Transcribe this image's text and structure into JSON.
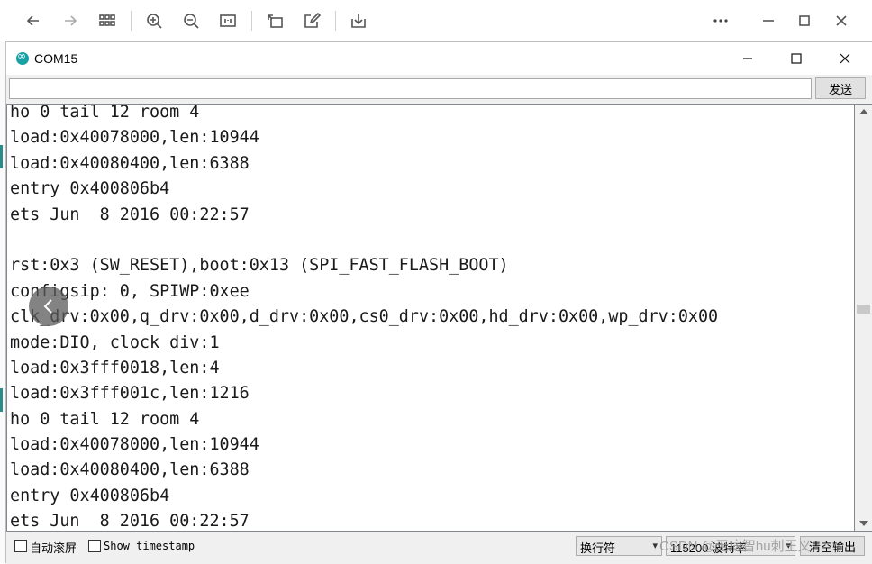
{
  "viewer_toolbar": {
    "icons": [
      "back-arrow-icon",
      "forward-arrow-icon",
      "grid-icon",
      "zoom-in-icon",
      "zoom-out-icon",
      "actual-size-icon",
      "rotate-icon",
      "edit-icon",
      "download-icon",
      "more-icon",
      "minimize-icon",
      "maximize-icon",
      "close-icon"
    ]
  },
  "window": {
    "title": "COM15",
    "controls": [
      "minimize-icon",
      "maximize-icon",
      "close-icon"
    ]
  },
  "send": {
    "input_value": "",
    "button_label": "发送"
  },
  "output": {
    "lines": [
      "ho 0 tail 12 room 4",
      "load:0x40078000,len:10944",
      "load:0x40080400,len:6388",
      "entry 0x400806b4",
      "ets Jun  8 2016 00:22:57",
      "",
      "rst:0x3 (SW_RESET),boot:0x13 (SPI_FAST_FLASH_BOOT)",
      "configsip: 0, SPIWP:0xee",
      "clk_drv:0x00,q_drv:0x00,d_drv:0x00,cs0_drv:0x00,hd_drv:0x00,wp_drv:0x00",
      "mode:DIO, clock div:1",
      "load:0x3fff0018,len:4",
      "load:0x3fff001c,len:1216",
      "ho 0 tail 12 room 4",
      "load:0x40078000,len:10944",
      "load:0x40080400,len:6388",
      "entry 0x400806b4",
      "ets Jun  8 2016 00:22:57"
    ]
  },
  "status": {
    "autoscroll_label": "自动滚屏",
    "autoscroll_checked": false,
    "timestamp_label": "Show timestamp",
    "timestamp_checked": false,
    "line_ending": "换行符",
    "baud": "115200 波特率",
    "clear_label": "清空输出"
  },
  "watermark": "CSDN @无病智hu刺王义"
}
